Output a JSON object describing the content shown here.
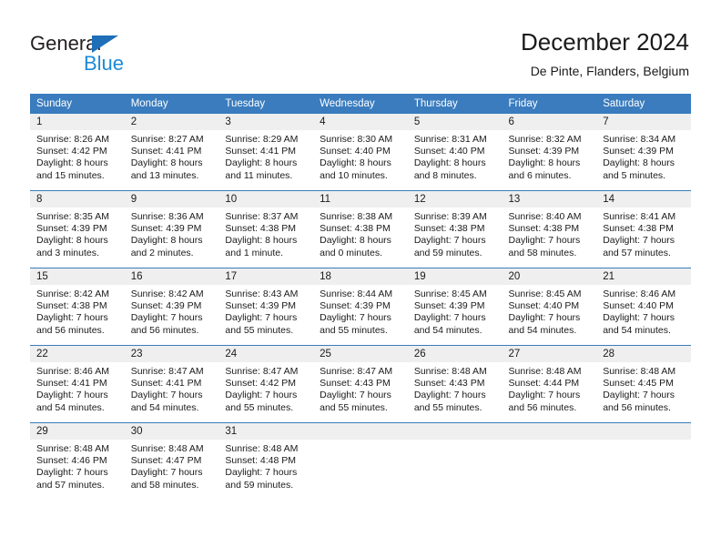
{
  "logo": {
    "word_one": "General",
    "word_two": "Blue",
    "triangle_color": "#1e6fb8",
    "word_two_color": "#1e8ad6"
  },
  "header": {
    "title": "December 2024",
    "subtitle": "De Pinte, Flanders, Belgium"
  },
  "theme": {
    "header_blue": "#3a7cbe",
    "daynum_band": "#efefef",
    "text": "#1a1a1a"
  },
  "calendar": {
    "weekday_headers": [
      "Sunday",
      "Monday",
      "Tuesday",
      "Wednesday",
      "Thursday",
      "Friday",
      "Saturday"
    ],
    "weeks": [
      [
        {
          "day": "1",
          "sunrise": "Sunrise: 8:26 AM",
          "sunset": "Sunset: 4:42 PM",
          "daylight_1": "Daylight: 8 hours",
          "daylight_2": "and 15 minutes."
        },
        {
          "day": "2",
          "sunrise": "Sunrise: 8:27 AM",
          "sunset": "Sunset: 4:41 PM",
          "daylight_1": "Daylight: 8 hours",
          "daylight_2": "and 13 minutes."
        },
        {
          "day": "3",
          "sunrise": "Sunrise: 8:29 AM",
          "sunset": "Sunset: 4:41 PM",
          "daylight_1": "Daylight: 8 hours",
          "daylight_2": "and 11 minutes."
        },
        {
          "day": "4",
          "sunrise": "Sunrise: 8:30 AM",
          "sunset": "Sunset: 4:40 PM",
          "daylight_1": "Daylight: 8 hours",
          "daylight_2": "and 10 minutes."
        },
        {
          "day": "5",
          "sunrise": "Sunrise: 8:31 AM",
          "sunset": "Sunset: 4:40 PM",
          "daylight_1": "Daylight: 8 hours",
          "daylight_2": "and 8 minutes."
        },
        {
          "day": "6",
          "sunrise": "Sunrise: 8:32 AM",
          "sunset": "Sunset: 4:39 PM",
          "daylight_1": "Daylight: 8 hours",
          "daylight_2": "and 6 minutes."
        },
        {
          "day": "7",
          "sunrise": "Sunrise: 8:34 AM",
          "sunset": "Sunset: 4:39 PM",
          "daylight_1": "Daylight: 8 hours",
          "daylight_2": "and 5 minutes."
        }
      ],
      [
        {
          "day": "8",
          "sunrise": "Sunrise: 8:35 AM",
          "sunset": "Sunset: 4:39 PM",
          "daylight_1": "Daylight: 8 hours",
          "daylight_2": "and 3 minutes."
        },
        {
          "day": "9",
          "sunrise": "Sunrise: 8:36 AM",
          "sunset": "Sunset: 4:39 PM",
          "daylight_1": "Daylight: 8 hours",
          "daylight_2": "and 2 minutes."
        },
        {
          "day": "10",
          "sunrise": "Sunrise: 8:37 AM",
          "sunset": "Sunset: 4:38 PM",
          "daylight_1": "Daylight: 8 hours",
          "daylight_2": "and 1 minute."
        },
        {
          "day": "11",
          "sunrise": "Sunrise: 8:38 AM",
          "sunset": "Sunset: 4:38 PM",
          "daylight_1": "Daylight: 8 hours",
          "daylight_2": "and 0 minutes."
        },
        {
          "day": "12",
          "sunrise": "Sunrise: 8:39 AM",
          "sunset": "Sunset: 4:38 PM",
          "daylight_1": "Daylight: 7 hours",
          "daylight_2": "and 59 minutes."
        },
        {
          "day": "13",
          "sunrise": "Sunrise: 8:40 AM",
          "sunset": "Sunset: 4:38 PM",
          "daylight_1": "Daylight: 7 hours",
          "daylight_2": "and 58 minutes."
        },
        {
          "day": "14",
          "sunrise": "Sunrise: 8:41 AM",
          "sunset": "Sunset: 4:38 PM",
          "daylight_1": "Daylight: 7 hours",
          "daylight_2": "and 57 minutes."
        }
      ],
      [
        {
          "day": "15",
          "sunrise": "Sunrise: 8:42 AM",
          "sunset": "Sunset: 4:38 PM",
          "daylight_1": "Daylight: 7 hours",
          "daylight_2": "and 56 minutes."
        },
        {
          "day": "16",
          "sunrise": "Sunrise: 8:42 AM",
          "sunset": "Sunset: 4:39 PM",
          "daylight_1": "Daylight: 7 hours",
          "daylight_2": "and 56 minutes."
        },
        {
          "day": "17",
          "sunrise": "Sunrise: 8:43 AM",
          "sunset": "Sunset: 4:39 PM",
          "daylight_1": "Daylight: 7 hours",
          "daylight_2": "and 55 minutes."
        },
        {
          "day": "18",
          "sunrise": "Sunrise: 8:44 AM",
          "sunset": "Sunset: 4:39 PM",
          "daylight_1": "Daylight: 7 hours",
          "daylight_2": "and 55 minutes."
        },
        {
          "day": "19",
          "sunrise": "Sunrise: 8:45 AM",
          "sunset": "Sunset: 4:39 PM",
          "daylight_1": "Daylight: 7 hours",
          "daylight_2": "and 54 minutes."
        },
        {
          "day": "20",
          "sunrise": "Sunrise: 8:45 AM",
          "sunset": "Sunset: 4:40 PM",
          "daylight_1": "Daylight: 7 hours",
          "daylight_2": "and 54 minutes."
        },
        {
          "day": "21",
          "sunrise": "Sunrise: 8:46 AM",
          "sunset": "Sunset: 4:40 PM",
          "daylight_1": "Daylight: 7 hours",
          "daylight_2": "and 54 minutes."
        }
      ],
      [
        {
          "day": "22",
          "sunrise": "Sunrise: 8:46 AM",
          "sunset": "Sunset: 4:41 PM",
          "daylight_1": "Daylight: 7 hours",
          "daylight_2": "and 54 minutes."
        },
        {
          "day": "23",
          "sunrise": "Sunrise: 8:47 AM",
          "sunset": "Sunset: 4:41 PM",
          "daylight_1": "Daylight: 7 hours",
          "daylight_2": "and 54 minutes."
        },
        {
          "day": "24",
          "sunrise": "Sunrise: 8:47 AM",
          "sunset": "Sunset: 4:42 PM",
          "daylight_1": "Daylight: 7 hours",
          "daylight_2": "and 55 minutes."
        },
        {
          "day": "25",
          "sunrise": "Sunrise: 8:47 AM",
          "sunset": "Sunset: 4:43 PM",
          "daylight_1": "Daylight: 7 hours",
          "daylight_2": "and 55 minutes."
        },
        {
          "day": "26",
          "sunrise": "Sunrise: 8:48 AM",
          "sunset": "Sunset: 4:43 PM",
          "daylight_1": "Daylight: 7 hours",
          "daylight_2": "and 55 minutes."
        },
        {
          "day": "27",
          "sunrise": "Sunrise: 8:48 AM",
          "sunset": "Sunset: 4:44 PM",
          "daylight_1": "Daylight: 7 hours",
          "daylight_2": "and 56 minutes."
        },
        {
          "day": "28",
          "sunrise": "Sunrise: 8:48 AM",
          "sunset": "Sunset: 4:45 PM",
          "daylight_1": "Daylight: 7 hours",
          "daylight_2": "and 56 minutes."
        }
      ],
      [
        {
          "day": "29",
          "sunrise": "Sunrise: 8:48 AM",
          "sunset": "Sunset: 4:46 PM",
          "daylight_1": "Daylight: 7 hours",
          "daylight_2": "and 57 minutes."
        },
        {
          "day": "30",
          "sunrise": "Sunrise: 8:48 AM",
          "sunset": "Sunset: 4:47 PM",
          "daylight_1": "Daylight: 7 hours",
          "daylight_2": "and 58 minutes."
        },
        {
          "day": "31",
          "sunrise": "Sunrise: 8:48 AM",
          "sunset": "Sunset: 4:48 PM",
          "daylight_1": "Daylight: 7 hours",
          "daylight_2": "and 59 minutes."
        },
        {
          "day": "",
          "sunrise": "",
          "sunset": "",
          "daylight_1": "",
          "daylight_2": ""
        },
        {
          "day": "",
          "sunrise": "",
          "sunset": "",
          "daylight_1": "",
          "daylight_2": ""
        },
        {
          "day": "",
          "sunrise": "",
          "sunset": "",
          "daylight_1": "",
          "daylight_2": ""
        },
        {
          "day": "",
          "sunrise": "",
          "sunset": "",
          "daylight_1": "",
          "daylight_2": ""
        }
      ]
    ]
  }
}
